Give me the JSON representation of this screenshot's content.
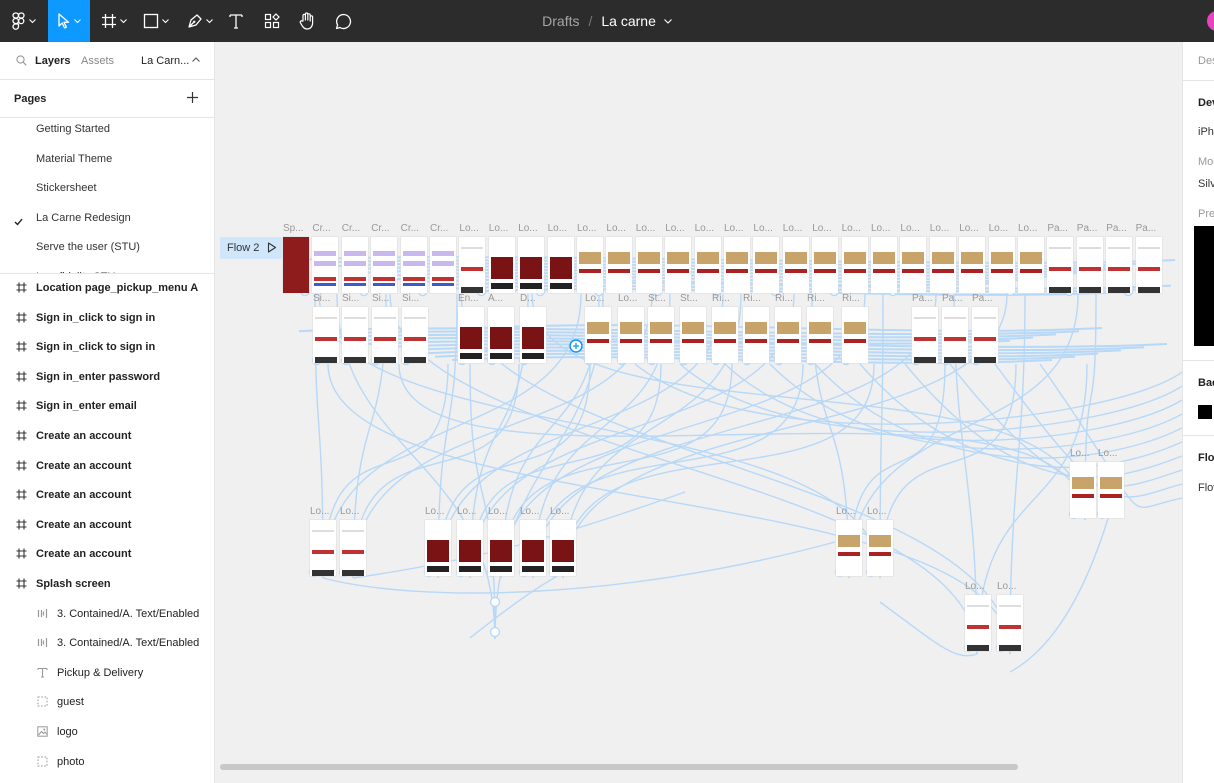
{
  "toolbar": {
    "breadcrumb_parent": "Drafts",
    "breadcrumb_sep": "/",
    "file_name": "La carne",
    "accent": "#0d99ff"
  },
  "left_panel": {
    "tabs": {
      "layers": "Layers",
      "assets": "Assets",
      "page": "La Carn..."
    },
    "pages_title": "Pages",
    "pages": [
      {
        "label": "Getting Started"
      },
      {
        "label": "Material Theme"
      },
      {
        "label": "Stickersheet"
      },
      {
        "label": "La Carne Redesign",
        "current": true
      },
      {
        "label": "Serve the user (STU)"
      },
      {
        "label": "Low fidelity STU"
      }
    ],
    "layers": [
      {
        "label": "Location page_pickup_menu A",
        "icon": "frame-icon"
      },
      {
        "label": "Sign in_click to sign in",
        "icon": "frame-icon"
      },
      {
        "label": "Sign in_click to sign in",
        "icon": "frame-icon"
      },
      {
        "label": "Sign in_enter password",
        "icon": "frame-icon"
      },
      {
        "label": "Sign in_enter email",
        "icon": "frame-icon"
      },
      {
        "label": "Create an account",
        "icon": "frame-icon"
      },
      {
        "label": "Create an account",
        "icon": "frame-icon"
      },
      {
        "label": "Create an account",
        "icon": "frame-icon"
      },
      {
        "label": "Create an account",
        "icon": "frame-icon"
      },
      {
        "label": "Create an account",
        "icon": "frame-icon"
      },
      {
        "label": "Splash screen",
        "icon": "frame-icon"
      },
      {
        "label": "3. Contained/A. Text/Enabled",
        "icon": "instance-icon"
      },
      {
        "label": "3. Contained/A. Text/Enabled",
        "icon": "instance-icon"
      },
      {
        "label": "Pickup & Delivery",
        "icon": "text-icon"
      },
      {
        "label": "guest",
        "icon": "group-icon"
      },
      {
        "label": "logo",
        "icon": "image-icon"
      },
      {
        "label": "photo",
        "icon": "group-icon"
      }
    ]
  },
  "canvas": {
    "flow_label": "Flow 2",
    "frame_labels_row1": [
      "Sp...",
      "Cr...",
      "Cr...",
      "Cr...",
      "Cr...",
      "Cr...",
      "Lo...",
      "Lo...",
      "Lo...",
      "Lo...",
      "Lo...",
      "Lo...",
      "Lo...",
      "Lo...",
      "Lo...",
      "Lo...",
      "Lo...",
      "Lo...",
      "Lo...",
      "Lo...",
      "Lo...",
      "Lo...",
      "Lo...",
      "Lo...",
      "Lo...",
      "Lo...",
      "Pa...",
      "Pa...",
      "Pa...",
      "Pa..."
    ],
    "frame_labels_row2": [
      "Si...",
      "Si...",
      "Si...",
      "Si...",
      "En...",
      "A...",
      "D...",
      "Lo...",
      "Lo...",
      "St...",
      "St...",
      "Ri...",
      "Ri...",
      "Ri...",
      "Ri...",
      "Ri...",
      "Pa...",
      "Pa...",
      "Pa..."
    ],
    "frame_labels_lower": [
      "Lo...",
      "Lo...",
      "Lo...",
      "Lo...",
      "Lo...",
      "Lo...",
      "Lo...",
      "Lo...",
      "Lo...",
      "Lo...",
      "Lo...",
      "Lo...",
      "Lo..."
    ],
    "connector_color": "#b8d8f7"
  },
  "right_panel": {
    "tab": "Des",
    "device_title": "Dev",
    "device_value": "iPho",
    "model_label": "Mod",
    "model_value": "Silv",
    "preview_label": "Prev",
    "background_title": "Bac",
    "flow_title": "Flov",
    "flow_value": "Flov"
  }
}
